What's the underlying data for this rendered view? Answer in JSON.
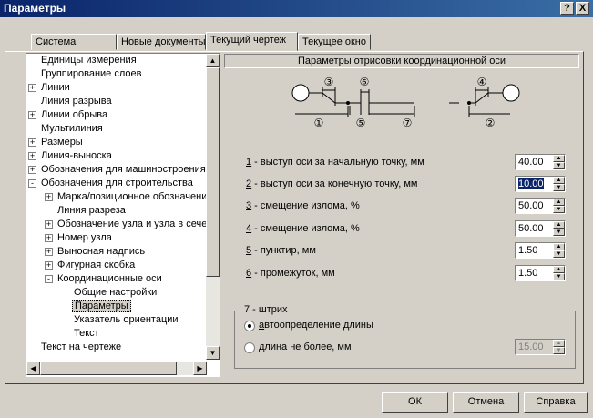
{
  "window": {
    "title": "Параметры",
    "help_btn": "?",
    "close_btn": "X"
  },
  "tabs": [
    "Система",
    "Новые документы",
    "Текущий чертеж",
    "Текущее окно"
  ],
  "active_tab": 2,
  "tree": [
    {
      "label": "Единицы измерения",
      "level": 0,
      "expander": ""
    },
    {
      "label": "Группирование слоев",
      "level": 0,
      "expander": ""
    },
    {
      "label": "Линии",
      "level": 0,
      "expander": "+"
    },
    {
      "label": "Линия разрыва",
      "level": 0,
      "expander": ""
    },
    {
      "label": "Линии обрыва",
      "level": 0,
      "expander": "+"
    },
    {
      "label": "Мультилиния",
      "level": 0,
      "expander": ""
    },
    {
      "label": "Размеры",
      "level": 0,
      "expander": "+"
    },
    {
      "label": "Линия-выноска",
      "level": 0,
      "expander": "+"
    },
    {
      "label": "Обозначения для машиностроения",
      "level": 0,
      "expander": "+"
    },
    {
      "label": "Обозначения для строительства",
      "level": 0,
      "expander": "-"
    },
    {
      "label": "Марка/позиционное обозначени",
      "level": 1,
      "expander": "+"
    },
    {
      "label": "Линия разреза",
      "level": 1,
      "expander": ""
    },
    {
      "label": "Обозначение узла и узла в сече",
      "level": 1,
      "expander": "+"
    },
    {
      "label": "Номер узла",
      "level": 1,
      "expander": "+"
    },
    {
      "label": "Выносная надпись",
      "level": 1,
      "expander": "+"
    },
    {
      "label": "Фигурная скобка",
      "level": 1,
      "expander": "+"
    },
    {
      "label": "Координационные оси",
      "level": 1,
      "expander": "-"
    },
    {
      "label": "Общие настройки",
      "level": 2,
      "expander": ""
    },
    {
      "label": "Параметры",
      "level": 2,
      "expander": "",
      "selected": true
    },
    {
      "label": "Указатель ориентации",
      "level": 2,
      "expander": ""
    },
    {
      "label": "Текст",
      "level": 2,
      "expander": ""
    },
    {
      "label": "Текст на чертеже",
      "level": 0,
      "expander": ""
    }
  ],
  "panel": {
    "header": "Параметры отрисовки координационной оси",
    "diagram_labels": [
      "①",
      "②",
      "③",
      "④",
      "⑤",
      "⑥",
      "⑦"
    ],
    "rows": [
      {
        "num": "1",
        "text": " - выступ оси за начальную точку, мм",
        "value": "40.00",
        "highlight": false
      },
      {
        "num": "2",
        "text": " - выступ оси за конечную точку, мм",
        "value": "10.00",
        "highlight": true
      },
      {
        "num": "3",
        "text": " - смещение излома, %",
        "value": "50.00",
        "highlight": false
      },
      {
        "num": "4",
        "text": " - смещение излома, %",
        "value": "50.00",
        "highlight": false
      },
      {
        "num": "5",
        "text": " - пунктир, мм",
        "value": "1.50",
        "highlight": false
      },
      {
        "num": "6",
        "text": " - промежуток, мм",
        "value": "1.50",
        "highlight": false
      }
    ],
    "group": {
      "legend": "7 - штрих",
      "auto_label_u": "а",
      "auto_label_rest": "втоопределение длины",
      "max_label_u": "д",
      "max_label_rest": "лина не более, мм",
      "max_value": "15.00",
      "selected": "auto"
    }
  },
  "buttons": {
    "ok": "ОК",
    "cancel": "Отмена",
    "help": "Справка"
  }
}
